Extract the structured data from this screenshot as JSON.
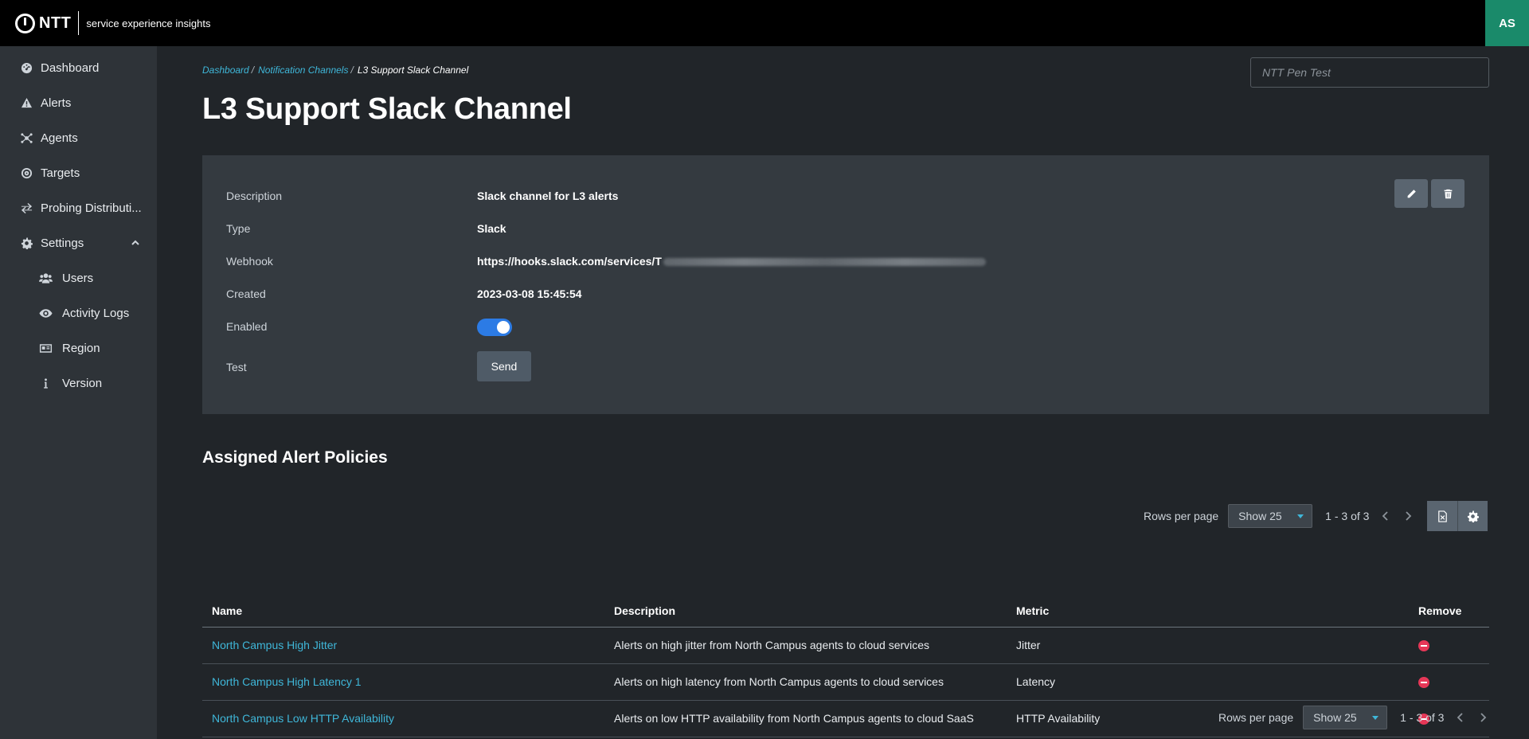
{
  "app": {
    "brand": "NTT",
    "subtitle": "service experience insights",
    "user_initials": "AS"
  },
  "sidebar": {
    "items": [
      {
        "label": "Dashboard",
        "icon": "dashboard-icon"
      },
      {
        "label": "Alerts",
        "icon": "warning-icon"
      },
      {
        "label": "Agents",
        "icon": "network-icon"
      },
      {
        "label": "Targets",
        "icon": "target-icon"
      },
      {
        "label": "Probing Distributi...",
        "icon": "exchange-icon"
      },
      {
        "label": "Settings",
        "icon": "gear-icon",
        "expanded": true
      }
    ],
    "sub_items": [
      {
        "label": "Users",
        "icon": "users-icon"
      },
      {
        "label": "Activity Logs",
        "icon": "eye-icon"
      },
      {
        "label": "Region",
        "icon": "id-card-icon"
      },
      {
        "label": "Version",
        "icon": "info-icon"
      }
    ]
  },
  "breadcrumb": {
    "items": [
      "Dashboard",
      "Notification Channels"
    ],
    "current": "L3 Support Slack Channel"
  },
  "tenant_selector": {
    "placeholder": "NTT Pen Test"
  },
  "page": {
    "title": "L3 Support Slack Channel"
  },
  "details": {
    "description_label": "Description",
    "description_value": "Slack channel for L3 alerts",
    "type_label": "Type",
    "type_value": "Slack",
    "webhook_label": "Webhook",
    "webhook_value": "https://hooks.slack.com/services/T",
    "created_label": "Created",
    "created_value": "2023-03-08 15:45:54",
    "enabled_label": "Enabled",
    "enabled_value": true,
    "test_label": "Test",
    "send_label": "Send"
  },
  "policies": {
    "title": "Assigned Alert Policies",
    "rows_per_page_label": "Rows per page",
    "rows_per_page_value": "Show 25",
    "page_info": "1 - 3 of 3",
    "columns": [
      "Name",
      "Description",
      "Metric",
      "Remove"
    ],
    "rows": [
      {
        "name": "North Campus High Jitter",
        "description": "Alerts on high jitter from North Campus agents to cloud services",
        "metric": "Jitter"
      },
      {
        "name": "North Campus High Latency 1",
        "description": "Alerts on high latency from North Campus agents to cloud services",
        "metric": "Latency"
      },
      {
        "name": "North Campus Low HTTP Availability",
        "description": "Alerts on low HTTP availability from North Campus agents to cloud SaaS",
        "metric": "HTTP Availability"
      }
    ]
  },
  "colors": {
    "accent": "#3fb7d9",
    "toggle": "#2c7be5",
    "avatar": "#1a8a6a",
    "remove": "#e63757"
  }
}
